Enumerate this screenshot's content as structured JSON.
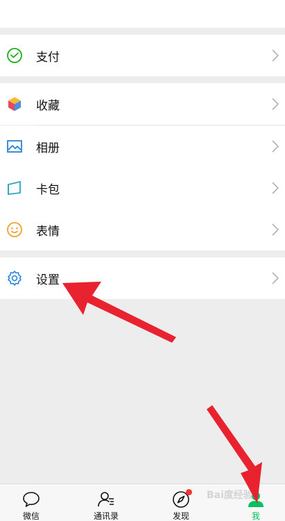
{
  "menu": {
    "pay": "支付",
    "favorites": "收藏",
    "album": "相册",
    "cards": "卡包",
    "stickers": "表情",
    "settings": "设置"
  },
  "tabbar": {
    "chats": "微信",
    "contacts": "通讯录",
    "discover": "发现",
    "me": "我"
  },
  "watermark": "Bai度经验",
  "colors": {
    "accent": "#07c160",
    "badge": "#f43530",
    "arrow": "#e8232f"
  }
}
